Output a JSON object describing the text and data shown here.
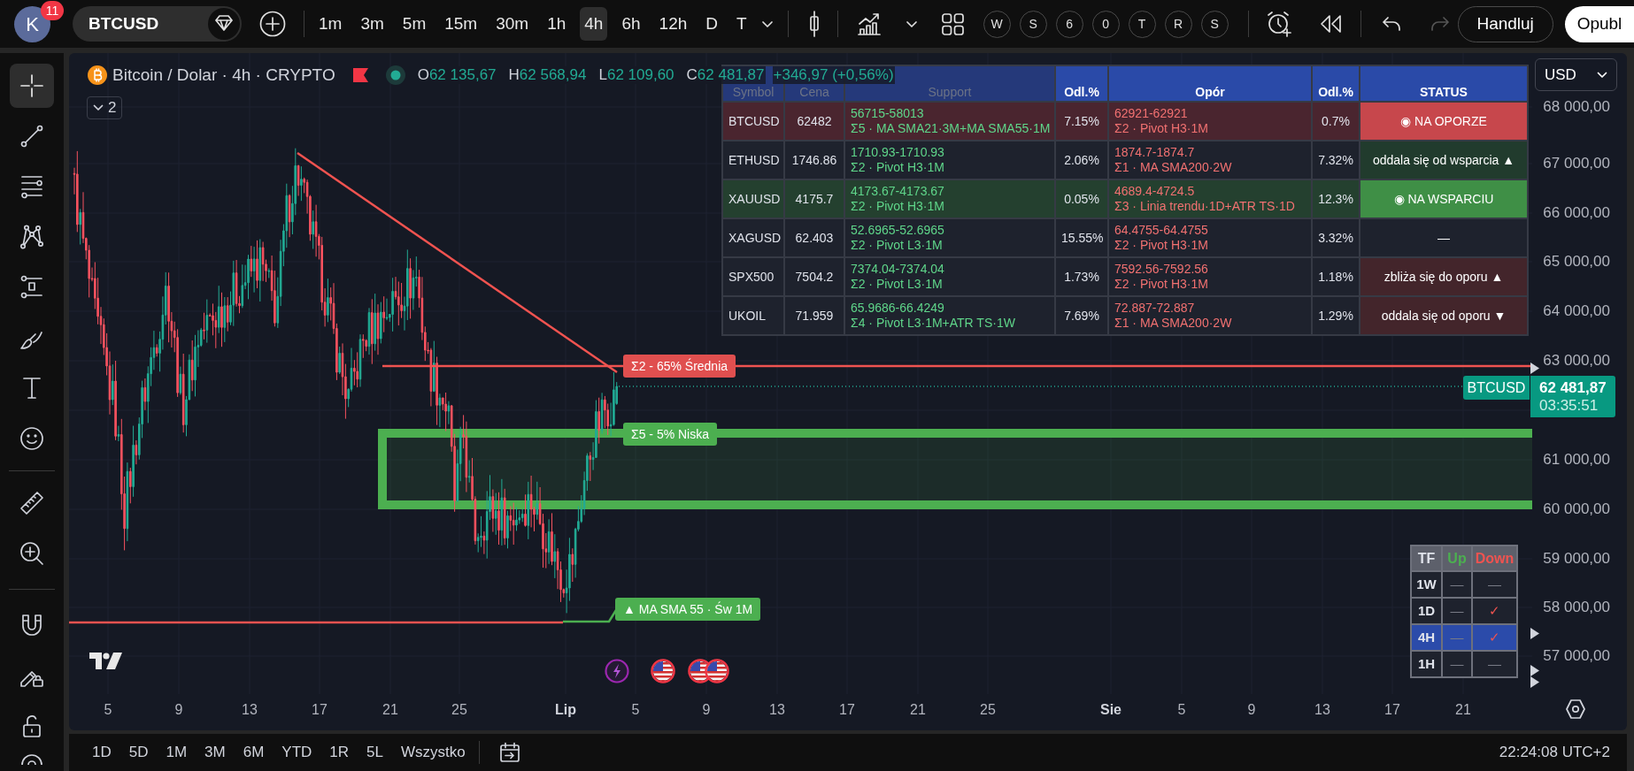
{
  "toolbar": {
    "avatar": {
      "initial": "K",
      "badge": "11"
    },
    "symbol": "BTCUSD",
    "intervals": [
      {
        "label": "1m",
        "selected": false
      },
      {
        "label": "3m",
        "selected": false
      },
      {
        "label": "5m",
        "selected": false
      },
      {
        "label": "15m",
        "selected": false
      },
      {
        "label": "30m",
        "selected": false
      },
      {
        "label": "1h",
        "selected": false
      },
      {
        "label": "4h",
        "selected": true
      },
      {
        "label": "6h",
        "selected": false
      },
      {
        "label": "12h",
        "selected": false
      },
      {
        "label": "D",
        "selected": false
      },
      {
        "label": "T",
        "selected": false
      }
    ],
    "layouts": [
      "W",
      "S",
      "6",
      "0",
      "T",
      "R",
      "S"
    ],
    "history": [
      {
        "disabled": false
      },
      {
        "disabled": true
      }
    ],
    "trade_button": "Handluj",
    "publish_button": "Opubl"
  },
  "drawing_tools": [
    {
      "selected": true
    },
    {
      "selected": false
    },
    {
      "selected": false
    },
    {
      "selected": false
    },
    {
      "selected": false
    },
    {
      "selected": false
    },
    {
      "selected": false
    },
    {
      "selected": false
    },
    {
      "selected": false
    },
    {
      "selected": false
    },
    {
      "selected": false
    },
    {
      "selected": false
    },
    {
      "selected": false
    },
    {
      "selected": false
    }
  ],
  "chart": {
    "legend": {
      "title": "Bitcoin / Dolar · 4h · CRYPTO",
      "ohlc": [
        {
          "label": "O",
          "value": "62 135,67"
        },
        {
          "label": "H",
          "value": "62 568,94"
        },
        {
          "label": "L",
          "value": "62 109,60"
        },
        {
          "label": "C",
          "value": "62 481,87"
        }
      ],
      "change": "+346,97 (+0,56%)",
      "hidden_indicators": "2"
    },
    "screener": {
      "columns": [
        "Symbol",
        "Cena",
        "Support",
        "Odl.%",
        "Opór",
        "Odl.%",
        "STATUS"
      ],
      "rows": [
        {
          "kind": "resistance",
          "symbol": "BTCUSD",
          "price": "62482",
          "support": {
            "range": "56715-58013",
            "source": "Σ5 · MA SMA21·3M+MA SMA55·1M"
          },
          "support_distance": "7.15%",
          "resistance": {
            "range": "62921-62921",
            "source": "Σ2 · Pivot H3·1M"
          },
          "resistance_distance": "0.7%",
          "status": {
            "kind": "at_resistance",
            "text": "◉ NA OPORZE"
          }
        },
        {
          "kind": "neutral",
          "symbol": "ETHUSD",
          "price": "1746.86",
          "support": {
            "range": "1710.93-1710.93",
            "source": "Σ2 · Pivot H3·1M"
          },
          "support_distance": "2.06%",
          "resistance": {
            "range": "1874.7-1874.7",
            "source": "Σ1 · MA SMA200·2W"
          },
          "resistance_distance": "7.32%",
          "status": {
            "kind": "leaving_support",
            "text": "oddala się od wsparcia ▲"
          }
        },
        {
          "kind": "support",
          "symbol": "XAUUSD",
          "price": "4175.7",
          "support": {
            "range": "4173.67-4173.67",
            "source": "Σ2 · Pivot H3·1M"
          },
          "support_distance": "0.05%",
          "resistance": {
            "range": "4689.4-4724.5",
            "source": "Σ3 · Linia trendu·1D+ATR TS·1D"
          },
          "resistance_distance": "12.3%",
          "status": {
            "kind": "at_support",
            "text": "◉ NA WSPARCIU"
          }
        },
        {
          "kind": "neutral",
          "symbol": "XAGUSD",
          "price": "62.403",
          "support": {
            "range": "52.6965-52.6965",
            "source": "Σ2 · Pivot L3·1M"
          },
          "support_distance": "15.55%",
          "resistance": {
            "range": "64.4755-64.4755",
            "source": "Σ2 · Pivot H3·1M"
          },
          "resistance_distance": "3.32%",
          "status": {
            "kind": "none",
            "text": "—"
          }
        },
        {
          "kind": "neutral",
          "symbol": "SPX500",
          "price": "7504.2",
          "support": {
            "range": "7374.04-7374.04",
            "source": "Σ2 · Pivot L3·1M"
          },
          "support_distance": "1.73%",
          "resistance": {
            "range": "7592.56-7592.56",
            "source": "Σ2 · Pivot H3·1M"
          },
          "resistance_distance": "1.18%",
          "status": {
            "kind": "near_resistance",
            "text": "zbliża się do oporu ▲"
          }
        },
        {
          "kind": "neutral",
          "symbol": "UKOIL",
          "price": "71.959",
          "support": {
            "range": "65.9686-66.4249",
            "source": "Σ4 · Pivot L3·1M+ATR TS·1W"
          },
          "support_distance": "7.69%",
          "resistance": {
            "range": "72.887-72.887",
            "source": "Σ1 · MA SMA200·2W"
          },
          "resistance_distance": "1.29%",
          "status": {
            "kind": "leaving_resistance",
            "text": "oddala się od oporu ▼"
          }
        }
      ]
    },
    "drawings": [
      {
        "kind": "trend_line"
      },
      {
        "kind": "resistance",
        "label": "Σ2 - 65% Średnia"
      },
      {
        "kind": "support",
        "label": "Σ5 - 5% Niska"
      },
      {
        "kind": "moving_average",
        "label": "▲ MA SMA 55 · Św 1M"
      }
    ],
    "currency": "USD",
    "price_axis": [
      "68 000,00",
      "67 000,00",
      "66 000,00",
      "65 000,00",
      "64 000,00",
      "63 000,00",
      "61 000,00",
      "60 000,00",
      "59 000,00",
      "58 000,00",
      "57 000,00"
    ],
    "symbol_label": "BTCUSD",
    "last_price": "62 481,87",
    "countdown": "03:35:51",
    "time_axis": [
      {
        "text": "5",
        "kind": "day"
      },
      {
        "text": "9",
        "kind": "day"
      },
      {
        "text": "13",
        "kind": "day"
      },
      {
        "text": "17",
        "kind": "day"
      },
      {
        "text": "21",
        "kind": "day"
      },
      {
        "text": "25",
        "kind": "day"
      },
      {
        "text": "Lip",
        "kind": "month"
      },
      {
        "text": "5",
        "kind": "day"
      },
      {
        "text": "9",
        "kind": "day"
      },
      {
        "text": "13",
        "kind": "day"
      },
      {
        "text": "17",
        "kind": "day"
      },
      {
        "text": "21",
        "kind": "day"
      },
      {
        "text": "25",
        "kind": "day"
      },
      {
        "text": "Sie",
        "kind": "month"
      },
      {
        "text": "5",
        "kind": "day"
      },
      {
        "text": "9",
        "kind": "day"
      },
      {
        "text": "13",
        "kind": "day"
      },
      {
        "text": "17",
        "kind": "day"
      },
      {
        "text": "21",
        "kind": "day"
      }
    ],
    "trend_table": {
      "columns": [
        {
          "label": "TF",
          "kind": "timeframe"
        },
        {
          "label": "Up",
          "kind": "up"
        },
        {
          "label": "Down",
          "kind": "down"
        }
      ],
      "rows": [
        {
          "timeframe": "1W",
          "up": {
            "text": "—",
            "active": false
          },
          "down": {
            "text": "—",
            "active": false
          },
          "selected": false
        },
        {
          "timeframe": "1D",
          "up": {
            "text": "—",
            "active": false
          },
          "down": {
            "text": "✓",
            "active": true
          },
          "selected": false
        },
        {
          "timeframe": "4H",
          "up": {
            "text": "—",
            "active": false
          },
          "down": {
            "text": "✓",
            "active": true
          },
          "selected": true
        },
        {
          "timeframe": "1H",
          "up": {
            "text": "—",
            "active": false
          },
          "down": {
            "text": "—",
            "active": false
          },
          "selected": false
        }
      ]
    }
  },
  "bottom_bar": {
    "ranges": [
      "1D",
      "5D",
      "1M",
      "3M",
      "6M",
      "YTD",
      "1R",
      "5L",
      "Wszystko"
    ],
    "clock": "22:24:08 UTC+2"
  }
}
